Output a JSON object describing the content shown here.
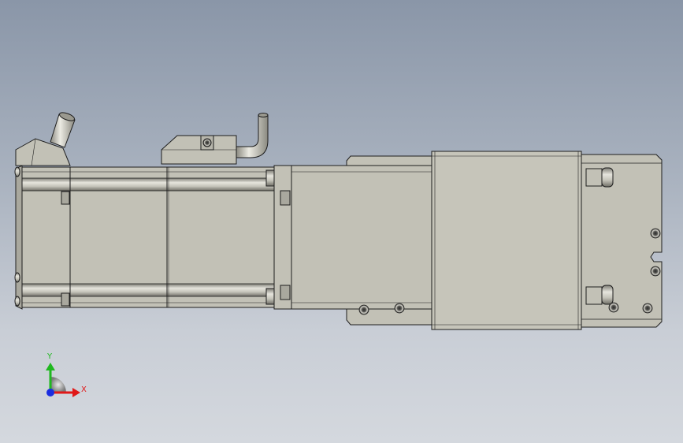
{
  "viewport": {
    "background_top": "#8a96a8",
    "background_bottom": "#d4d8de"
  },
  "model": {
    "body_color": "#c2c1b6",
    "edge_color": "#1e1e1e",
    "shadow_color": "#8e8d84",
    "highlight_color": "#e3e2da"
  },
  "triad": {
    "x_label": "X",
    "y_label": "Y",
    "x_color": "#e01818",
    "y_color": "#1fb81f",
    "z_color": "#1a2de0"
  }
}
